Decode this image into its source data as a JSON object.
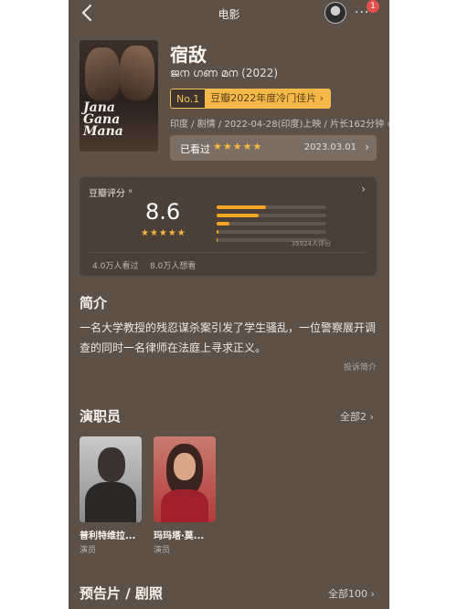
{
  "header": {
    "title": "电影",
    "notification_count": "1",
    "more_label": "···"
  },
  "movie": {
    "title": "宿敌",
    "original_title": "ജന ഗണ മന (2022)",
    "poster_text": "Jana Gana Mana",
    "rank_no": "No.1",
    "rank_label": "豆瓣2022年度冷门佳片 ›",
    "meta": "印度 / 剧情 / 2022-04-28(印度)上映 / 片长162分钟 ›",
    "seen_label": "已看过",
    "seen_stars": "★★★★★",
    "seen_date": "2023.03.01",
    "seen_chevron": "›"
  },
  "rating": {
    "heading": "豆瓣评分 °",
    "score": "8.6",
    "stars": "★★★★★",
    "distribution": [
      {
        "label": "★★★★★",
        "fraction": 0.45
      },
      {
        "label": "★★★★",
        "fraction": 0.38
      },
      {
        "label": "★★★",
        "fraction": 0.12
      },
      {
        "label": "★★",
        "fraction": 0.02
      },
      {
        "label": "★",
        "fraction": 0.01
      }
    ],
    "votes": "35924人评分",
    "watched": "4.0万人看过",
    "wanted": "8.0万人想看",
    "chevron": "›"
  },
  "intro": {
    "heading": "简介",
    "text": "一名大学教授的残忍谋杀案引发了学生骚乱，一位警察展开调查的同时一名律师在法庭上寻求正义。",
    "complain": "投诉简介"
  },
  "cast": {
    "heading": "演职员",
    "all_label": "全部2 ›",
    "members": [
      {
        "name": "普利特维拉...",
        "role": "演员"
      },
      {
        "name": "玛玛塔·莫...",
        "role": "演员"
      }
    ]
  },
  "trailers": {
    "heading": "预告片 / 剧照",
    "all_label": "全部100 ›"
  },
  "colors": {
    "background": "#5c5047",
    "accent": "#f5b94a",
    "star": "#f6b73c"
  }
}
